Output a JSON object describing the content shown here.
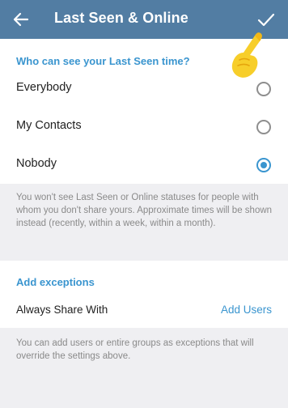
{
  "appbar": {
    "title": "Last Seen & Online",
    "back_icon": "arrow-left-icon",
    "confirm_icon": "checkmark-icon"
  },
  "last_seen": {
    "header": "Who can see your Last Seen time?",
    "options": [
      {
        "label": "Everybody",
        "selected": false
      },
      {
        "label": "My Contacts",
        "selected": false
      },
      {
        "label": "Nobody",
        "selected": true
      }
    ],
    "note": "You won't see Last Seen or Online statuses for people with whom you don't share yours. Approximate times will be shown instead (recently, within a week, within a month)."
  },
  "exceptions": {
    "header": "Add exceptions",
    "always_share_label": "Always Share With",
    "always_share_value": "Add Users",
    "note": "You can add users or entire groups as exceptions that will override the settings above."
  },
  "colors": {
    "appbar": "#527da3",
    "accent": "#3a95cf",
    "background": "#efeff2"
  }
}
